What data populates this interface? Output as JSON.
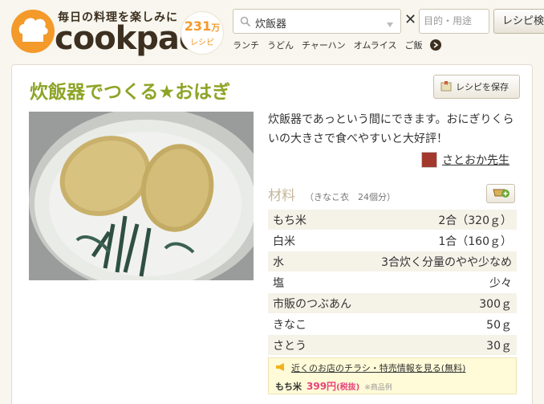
{
  "header": {
    "tagline": "毎日の料理を楽しみに",
    "brand": "cookpad",
    "recipe_count": "231",
    "recipe_count_unit": "万",
    "recipe_count_label": "レシピ",
    "search_value": "炊飯器",
    "clear_symbol": "✕",
    "purpose_placeholder": "目的・用途",
    "search_button_label": "レシピ検",
    "quick_links": [
      "ランチ",
      "うどん",
      "チャーハン",
      "オムライス",
      "ご飯"
    ]
  },
  "recipe": {
    "title": "炊飯器でつくる★おはぎ",
    "save_label": "レシピを保存",
    "description": "炊飯器であっという間にできます。おにぎりくらいの大きさで食べやすいと大好評！",
    "author": "さとおか先生"
  },
  "ingredients": {
    "heading": "材料",
    "servings": "（きなこ衣　24個分）",
    "items": [
      {
        "name": "もち米",
        "qty": "2合（320ｇ）"
      },
      {
        "name": "白米",
        "qty": "1合（160ｇ）"
      },
      {
        "name": "水",
        "qty": "3合炊く分量のやや少なめ"
      },
      {
        "name": "塩",
        "qty": "少々"
      },
      {
        "name": "市販のつぶあん",
        "qty": "300ｇ"
      },
      {
        "name": "きなこ",
        "qty": "50ｇ"
      },
      {
        "name": "さとう",
        "qty": "30ｇ"
      }
    ]
  },
  "promo": {
    "link_text": "近くのお店のチラシ・特売情報を見る(無料)",
    "item": "もち米",
    "price": "399円",
    "price_note": "(税抜)",
    "note": "※商品例"
  },
  "colors": {
    "brand_orange": "#f39a2b",
    "title_green": "#8da427",
    "price_pink": "#e8437e"
  }
}
